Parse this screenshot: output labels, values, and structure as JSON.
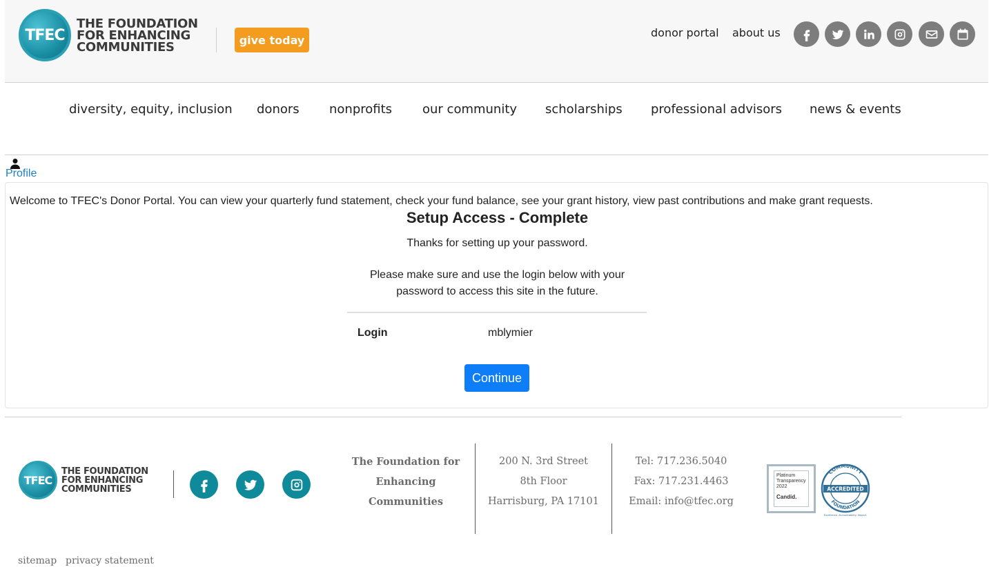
{
  "header": {
    "logo_mark": "TFEC",
    "logo_lines": [
      "THE FOUNDATION",
      "FOR ENHANCING",
      "COMMUNITIES"
    ],
    "give_label": "give today",
    "links": [
      "donor portal",
      "about us"
    ],
    "social_icons": [
      "facebook-icon",
      "twitter-icon",
      "linkedin-icon",
      "instagram-icon",
      "email-icon",
      "calendar-icon"
    ],
    "social_color": "#7d7d7d",
    "give_color": "#f39c20"
  },
  "nav": {
    "items": [
      "diversity, equity, inclusion",
      "donors",
      "nonprofits",
      "our community",
      "scholarships",
      "professional advisors",
      "news & events"
    ]
  },
  "profile": {
    "label": "Profile",
    "icon": "user-icon"
  },
  "card": {
    "welcome": "Welcome to TFEC's Donor Portal. You can view your quarterly fund statement, check your fund balance, see your grant history, view past contributions and make grant requests.",
    "title": "Setup Access - Complete",
    "thanks": "Thanks for setting up your password.",
    "please_line1": "Please make sure and use the login below with your",
    "please_line2": "password to access this site in the future.",
    "login_label": "Login",
    "login_value": "mblymier",
    "continue_label": "Continue",
    "button_color": "#0d7ef7"
  },
  "footer": {
    "logo_mark": "TFEC",
    "logo_lines": [
      "THE FOUNDATION",
      "FOR ENHANCING",
      "COMMUNITIES"
    ],
    "social_icons": [
      "facebook-icon",
      "twitter-icon",
      "instagram-icon"
    ],
    "social_color": "#0f8a9b",
    "org_name_lines": [
      "The Foundation for",
      "Enhancing",
      "Communities"
    ],
    "address_lines": [
      "200 N. 3rd Street",
      "8th Floor",
      "Harrisburg, PA 17101"
    ],
    "contact_lines": [
      "Tel:  717.236.5040",
      "Fax: 717.231.4463",
      "Email: info@tfec.org"
    ],
    "candid_badge": {
      "line1": "Platinum",
      "line2": "Transparency",
      "line3": "2022",
      "brand": "Candid."
    },
    "accredited_badge": {
      "top": "COMMUNITY",
      "middle": "ACCREDITED",
      "bottom": "FOUNDATION",
      "tagline": "Excellence. Accountability. Impact."
    },
    "bottom_links": [
      "sitemap",
      "privacy statement"
    ]
  }
}
